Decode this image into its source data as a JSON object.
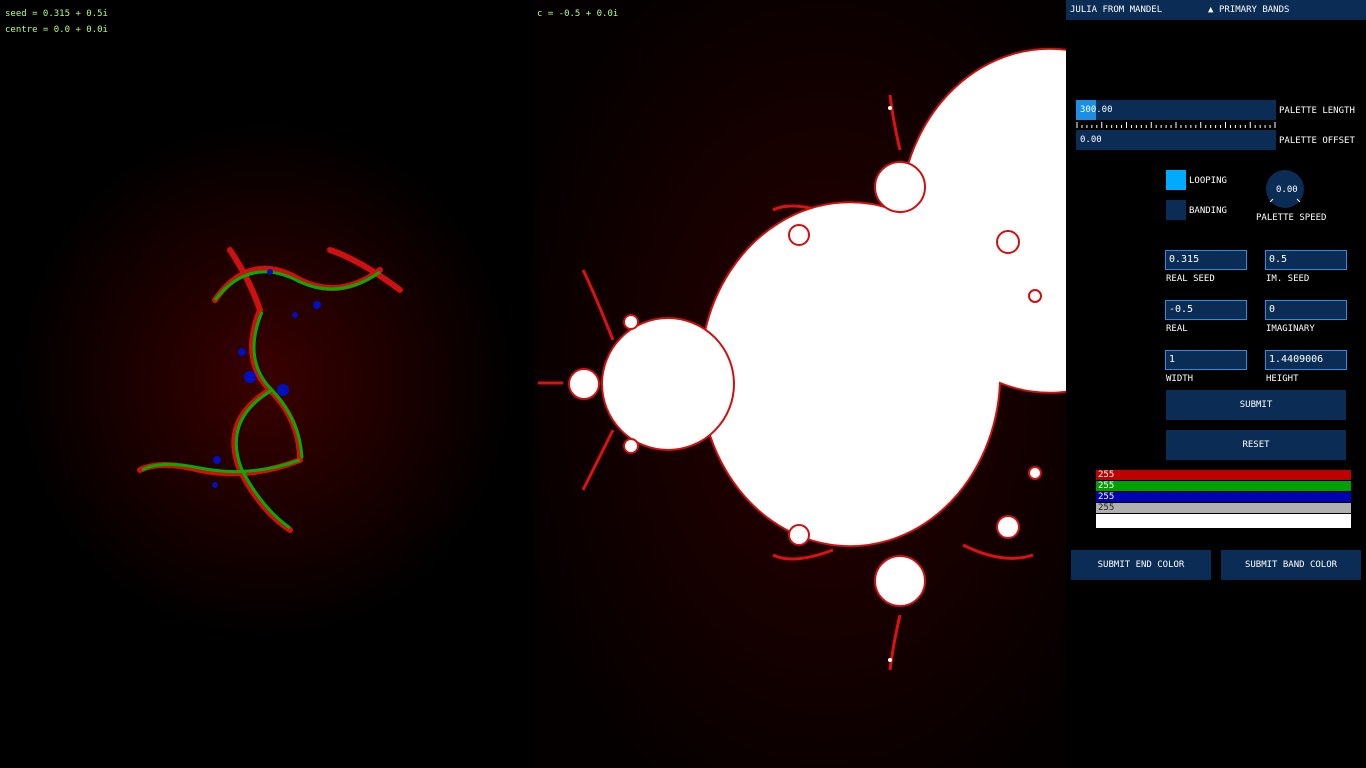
{
  "julia": {
    "seed_text": "seed = 0.315 + 0.5i",
    "centre_text": "centre = 0.0 + 0.0i"
  },
  "mandel": {
    "c_text": "c = -0.5 + 0.0i"
  },
  "panel": {
    "mode_dropdown": "JULIA FROM MANDEL",
    "palette_dropdown": "PRIMARY BANDS",
    "palette_length": {
      "value": "300.00",
      "label": "PALETTE LENGTH",
      "fill_fraction": 0.1
    },
    "palette_offset": {
      "value": "0.00",
      "label": "PALETTE OFFSET"
    },
    "looping_label": "LOOPING",
    "banding_label": "BANDING",
    "speed": {
      "value": "0.00",
      "label": "PALETTE SPEED"
    },
    "real_seed": {
      "value": "0.315",
      "label": "REAL SEED"
    },
    "im_seed": {
      "value": "0.5",
      "label": "IM. SEED"
    },
    "real": {
      "value": "-0.5",
      "label": "REAL"
    },
    "imaginary": {
      "value": "0",
      "label": "IMAGINARY"
    },
    "width": {
      "value": "1",
      "label": "WIDTH"
    },
    "height": {
      "value": "1.4409006",
      "label": "HEIGHT"
    },
    "submit_label": "SUBMIT",
    "reset_label": "RESET",
    "color_bars": [
      {
        "value": "255",
        "color": "#c00000"
      },
      {
        "value": "255",
        "color": "#00a000"
      },
      {
        "value": "255",
        "color": "#0000b0"
      },
      {
        "value": "255",
        "color": "#b0b0b0"
      }
    ],
    "end_color_label": "SUBMIT END COLOR",
    "band_color_label": "SUBMIT BAND COLOR"
  },
  "colors": {
    "accent": "#1b8fe6",
    "panel": "#0b2d55",
    "looping_on": "#00aaff"
  }
}
